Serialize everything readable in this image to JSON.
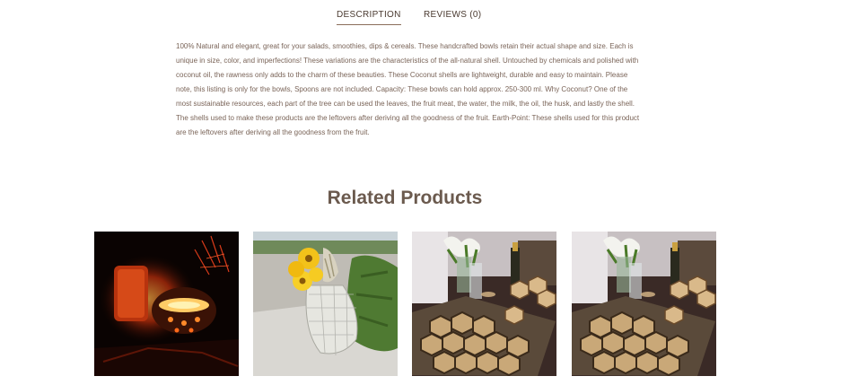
{
  "tabs": {
    "description": "DESCRIPTION",
    "reviews": "REVIEWS (0)"
  },
  "description_text": "100% Natural and elegant, great for your salads, smoothies, dips & cereals. These handcrafted bowls retain their actual shape and size. Each is unique in size, color, and imperfections! These variations are the characteristics of the all-natural shell. Untouched by chemicals and polished with coconut oil, the rawness only adds to the charm of these beauties. These Coconut shells are lightweight, durable and easy to maintain. Please note, this listing is only for the bowls, Spoons are not included. Capacity: These bowls can hold approx. 250-300 ml. Why Coconut? One of the most sustainable resources, each part of the tree can be used the leaves, the fruit meat, the water, the milk, the oil, the husk, and lastly the shell. The shells used to make these products are the leftovers after deriving all the goodness of the fruit. Earth-Point: These shells used for this product are the leftovers after deriving all the goodness from the fruit.",
  "related": {
    "title": "Related Products",
    "products": [
      {
        "image": "coconut-shell-candle-lamp-photo"
      },
      {
        "image": "flower-bouquet-in-net-bag-photo"
      },
      {
        "image": "hexagon-coaster-placemat-table-photo"
      },
      {
        "image": "hexagon-coaster-placemat-table-photo"
      }
    ]
  }
}
